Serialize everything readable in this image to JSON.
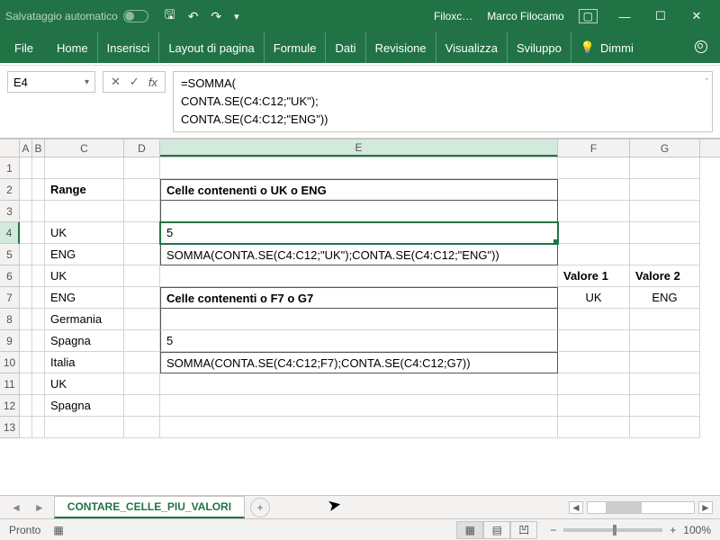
{
  "titlebar": {
    "autosave_label": "Salvataggio automatico",
    "doc_name": "Filoxc…",
    "user_name": "Marco Filocamo"
  },
  "ribbon": {
    "tabs": [
      "File",
      "Home",
      "Inserisci",
      "Layout di pagina",
      "Formule",
      "Dati",
      "Revisione",
      "Visualizza",
      "Sviluppo"
    ],
    "tell_me": "Dimmi"
  },
  "namebox": "E4",
  "formula": {
    "line1": "=SOMMA(",
    "line2": "CONTA.SE(C4:C12;\"UK\");",
    "line3": "CONTA.SE(C4:C12;\"ENG\"))"
  },
  "columns": [
    "A",
    "B",
    "C",
    "D",
    "E",
    "F",
    "G"
  ],
  "selected_col": "E",
  "selected_row": 4,
  "cells": {
    "C2": "Range",
    "E2": "Celle contenenti o UK o ENG",
    "C4": "UK",
    "E4": "5",
    "C5": "ENG",
    "E5": "SOMMA(CONTA.SE(C4:C12;\"UK\");CONTA.SE(C4:C12;\"ENG\"))",
    "C6": "UK",
    "F6": "Valore 1",
    "G6": "Valore 2",
    "C7": "ENG",
    "E7": "Celle contenenti o F7 o G7",
    "F7": "UK",
    "G7": "ENG",
    "C8": "Germania",
    "C9": "Spagna",
    "E9": "5",
    "C10": "Italia",
    "E10": "SOMMA(CONTA.SE(C4:C12;F7);CONTA.SE(C4:C12;G7))",
    "C11": "UK",
    "C12": "Spagna"
  },
  "sheet_tab": "CONTARE_CELLE_PIU_VALORI",
  "status": {
    "ready": "Pronto",
    "zoom": "100%"
  }
}
